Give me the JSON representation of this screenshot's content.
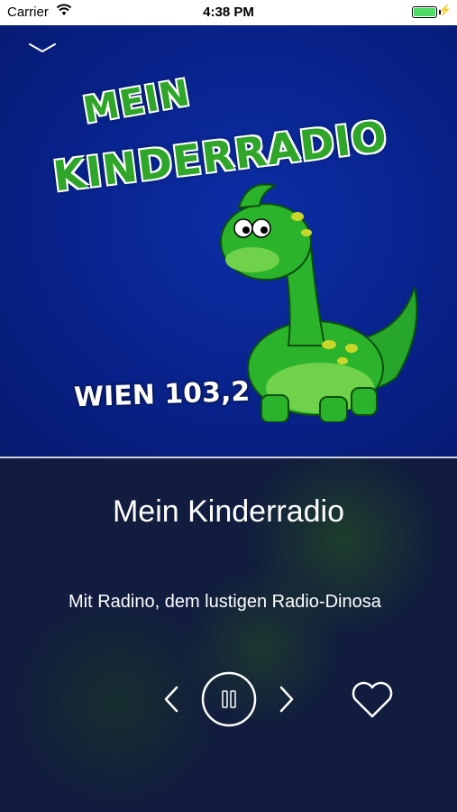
{
  "status_bar": {
    "carrier": "Carrier",
    "time": "4:38 PM"
  },
  "artwork": {
    "logo_line1": "MEIN",
    "logo_line2": "KINDERRADIO",
    "frequency_text": "WIEN 103,2"
  },
  "now_playing": {
    "station_name": "Mein Kinderradio",
    "description": "Mit Radino, dem lustigen Radio-Dinosa"
  },
  "controls": {
    "prev_icon": "chevron-left-icon",
    "play_state_icon": "pause-icon",
    "next_icon": "chevron-right-icon",
    "favorite_icon": "heart-icon"
  },
  "colors": {
    "accent": "#ffffff",
    "battery": "#4cd964",
    "logo_green": "#2fa62a",
    "art_bg": "#08228a"
  }
}
